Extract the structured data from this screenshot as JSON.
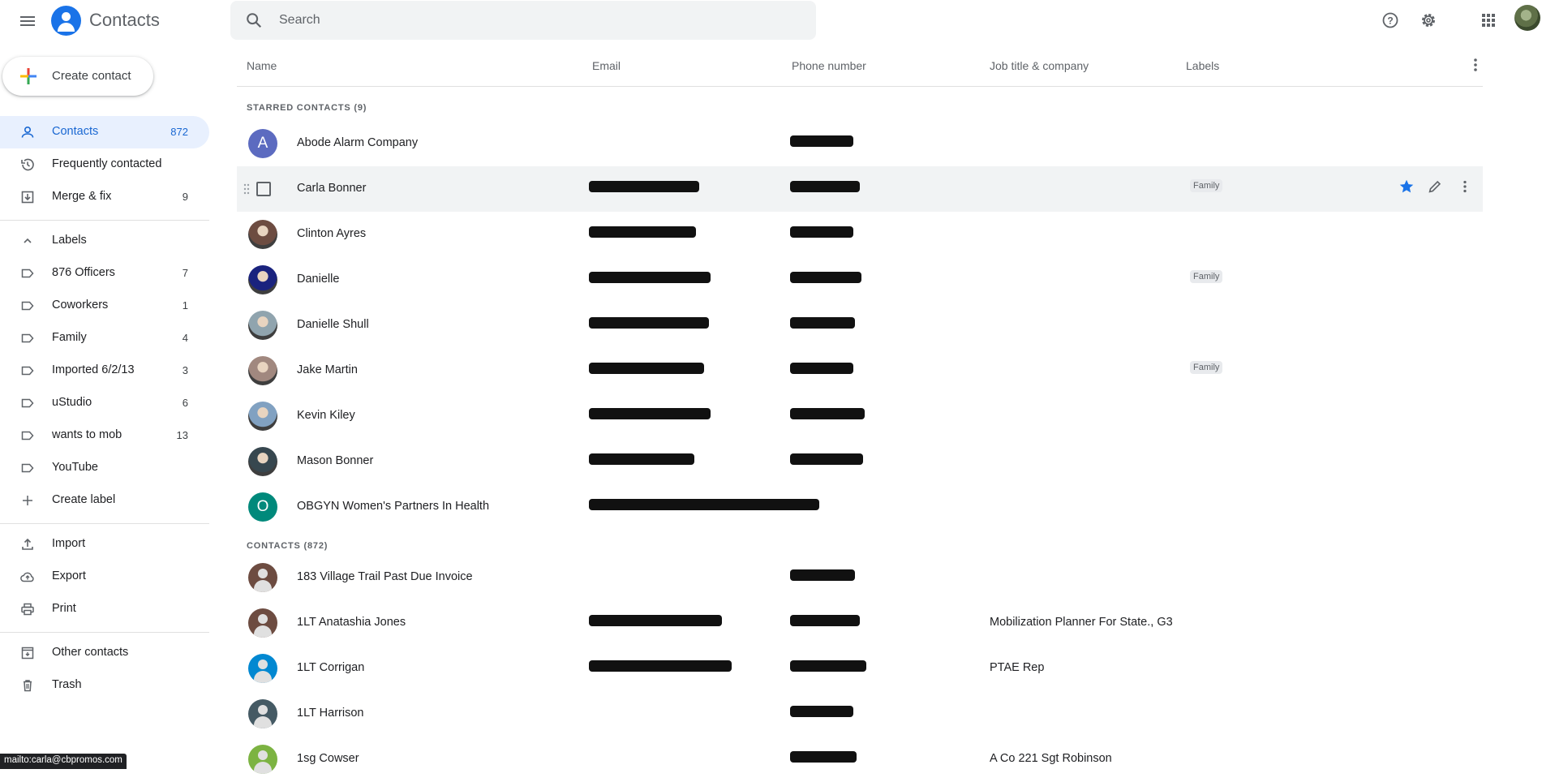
{
  "app": {
    "title": "Contacts"
  },
  "search": {
    "placeholder": "Search"
  },
  "sidebar": {
    "create_label": "Create contact",
    "nav": [
      {
        "label": "Contacts",
        "count": "872",
        "icon": "person-icon",
        "active": true
      },
      {
        "label": "Frequently contacted",
        "count": "",
        "icon": "history-icon"
      },
      {
        "label": "Merge & fix",
        "count": "9",
        "icon": "merge-icon"
      }
    ],
    "labels_header": "Labels",
    "labels": [
      {
        "label": "876 Officers",
        "count": "7"
      },
      {
        "label": "Coworkers",
        "count": "1"
      },
      {
        "label": "Family",
        "count": "4"
      },
      {
        "label": "Imported 6/2/13",
        "count": "3"
      },
      {
        "label": "uStudio",
        "count": "6"
      },
      {
        "label": "wants to mob",
        "count": "13"
      },
      {
        "label": "YouTube",
        "count": ""
      }
    ],
    "create_label_label": "Create label",
    "tools": [
      {
        "label": "Import",
        "icon": "import-icon"
      },
      {
        "label": "Export",
        "icon": "export-icon"
      },
      {
        "label": "Print",
        "icon": "print-icon"
      }
    ],
    "bottom": [
      {
        "label": "Other contacts",
        "icon": "other-contacts-icon"
      },
      {
        "label": "Trash",
        "icon": "trash-icon"
      }
    ]
  },
  "table": {
    "headers": {
      "name": "Name",
      "email": "Email",
      "phone": "Phone number",
      "job": "Job title & company",
      "labels": "Labels"
    },
    "starred_label": "STARRED CONTACTS (9)",
    "contacts_label": "CONTACTS (872)",
    "starred": [
      {
        "name": "Abode Alarm Company",
        "avatar": "A",
        "avatar_color": "#5c6bc0",
        "email_w": 0,
        "phone_w": 78,
        "job": "",
        "label": ""
      },
      {
        "name": "Carla Bonner",
        "avatar": "",
        "avatar_color": "",
        "email_w": 136,
        "phone_w": 86,
        "job": "",
        "label": "Family",
        "hover": true
      },
      {
        "name": "Clinton Ayres",
        "avatar": "photo",
        "avatar_color": "#6d4c41",
        "email_w": 132,
        "phone_w": 78,
        "job": "",
        "label": ""
      },
      {
        "name": "Danielle",
        "avatar": "photo",
        "avatar_color": "#1a237e",
        "email_w": 150,
        "phone_w": 88,
        "job": "",
        "label": "Family"
      },
      {
        "name": "Danielle Shull",
        "avatar": "photo",
        "avatar_color": "#90a4ae",
        "email_w": 148,
        "phone_w": 80,
        "job": "",
        "label": ""
      },
      {
        "name": "Jake Martin",
        "avatar": "photo",
        "avatar_color": "#a1887f",
        "email_w": 142,
        "phone_w": 78,
        "job": "",
        "label": "Family"
      },
      {
        "name": "Kevin Kiley",
        "avatar": "photo",
        "avatar_color": "#81a1c1",
        "email_w": 150,
        "phone_w": 92,
        "job": "",
        "label": ""
      },
      {
        "name": "Mason Bonner",
        "avatar": "photo",
        "avatar_color": "#37474f",
        "email_w": 130,
        "phone_w": 90,
        "job": "",
        "label": ""
      },
      {
        "name": "OBGYN Women's Partners In Health",
        "avatar": "O",
        "avatar_color": "#00897b",
        "email_w": 284,
        "phone_w": 0,
        "job": "",
        "label": ""
      }
    ],
    "contacts": [
      {
        "name": "183 Village Trail Past Due Invoice",
        "avatar": "generic",
        "avatar_color": "#6d4c41",
        "email_w": 0,
        "phone_w": 80,
        "job": "",
        "label": ""
      },
      {
        "name": "1LT Anatashia Jones",
        "avatar": "generic",
        "avatar_color": "#6d4c41",
        "email_w": 164,
        "phone_w": 86,
        "job": "Mobilization Planner For State., G3",
        "label": ""
      },
      {
        "name": "1LT Corrigan",
        "avatar": "generic",
        "avatar_color": "#0288d1",
        "email_w": 176,
        "phone_w": 94,
        "job": "PTAE Rep",
        "label": ""
      },
      {
        "name": "1LT Harrison",
        "avatar": "generic",
        "avatar_color": "#455a64",
        "email_w": 0,
        "phone_w": 78,
        "job": "",
        "label": ""
      },
      {
        "name": "1sg Cowser",
        "avatar": "generic",
        "avatar_color": "#7cb342",
        "email_w": 0,
        "phone_w": 82,
        "job": "A Co 221 Sgt Robinson",
        "label": ""
      }
    ]
  },
  "status_bar": "mailto:carla@cbpromos.com",
  "colors": {
    "accent": "#1a73e8",
    "active_bg": "#e8f0fe",
    "active_text": "#1967d2",
    "star": "#1a73e8"
  }
}
